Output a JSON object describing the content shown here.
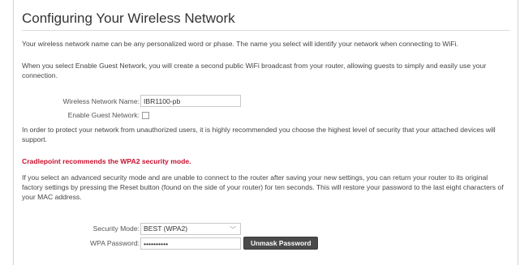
{
  "page": {
    "title": "Configuring Your Wireless Network",
    "intro_text": "Your wireless network name can be any personalized word or phase. The name you select will identify your network when connecting to WiFi.",
    "guest_text": "When you select Enable Guest Network, you will create a second public WiFi broadcast from your router, allowing guests to simply and easily use your connection.",
    "security_text": "In order to protect your network from unauthorized users, it is highly recommended you choose the highest level of security that your attached devices will support.",
    "recommendation": "Cradlepoint recommends the WPA2 security mode.",
    "reset_text": "If you select an advanced security mode and are unable to connect to the router after saving your new settings, you can return your router to its original factory settings by pressing the Reset button (found on the side of your router) for ten seconds. This will restore your password to the last eight characters of your MAC address."
  },
  "form": {
    "network_name_label": "Wireless Network Name:",
    "network_name_value": "IBR1100-pb",
    "guest_label": "Enable Guest Network:",
    "guest_checked": false,
    "security_mode_label": "Security Mode:",
    "security_mode_value": "BEST (WPA2)",
    "wpa_password_label": "WPA Password:",
    "wpa_password_value": "••••••••••",
    "unmask_button": "Unmask Password"
  },
  "colors": {
    "recommend": "#c8102e",
    "button": "#4a4a4a"
  }
}
